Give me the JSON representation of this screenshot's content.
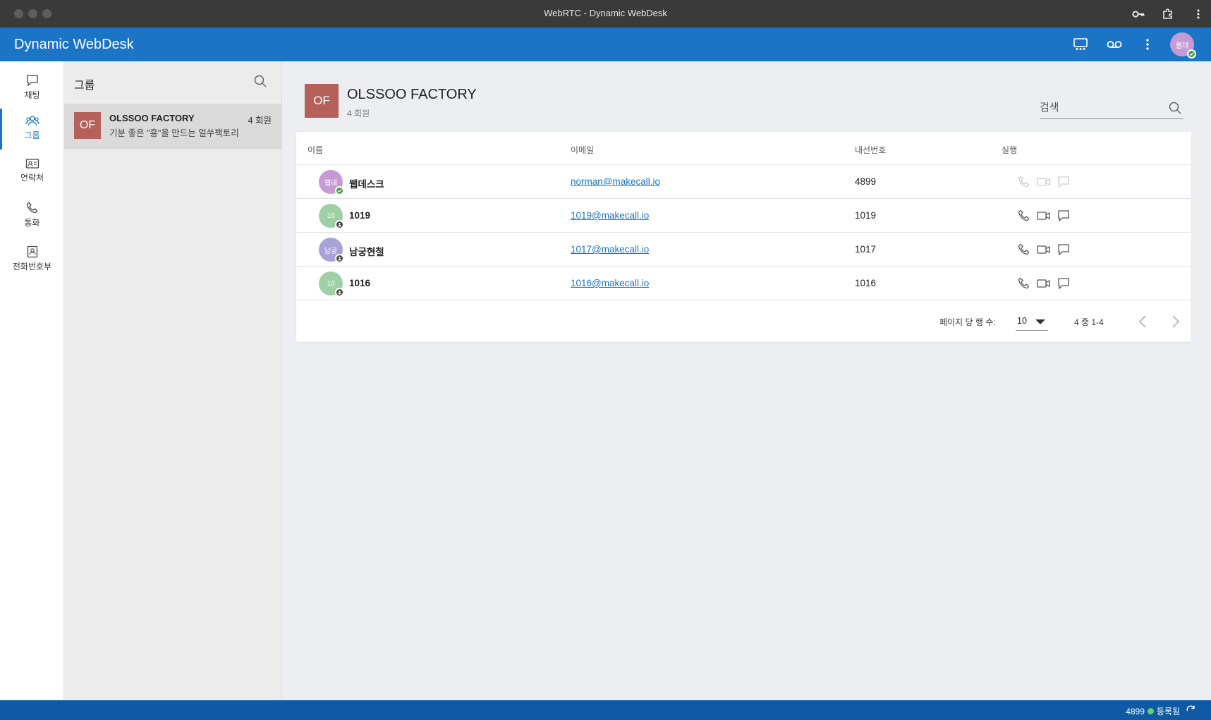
{
  "window": {
    "title": "WebRTC - Dynamic WebDesk"
  },
  "appbar": {
    "title": "Dynamic WebDesk",
    "avatar_text": "웹데"
  },
  "rail": {
    "items": [
      {
        "label": "채팅",
        "icon": "chat-icon"
      },
      {
        "label": "그룹",
        "icon": "group-icon",
        "active": true
      },
      {
        "label": "연락처",
        "icon": "contact-card-icon"
      },
      {
        "label": "통화",
        "icon": "phone-icon"
      },
      {
        "label": "전화번호부",
        "icon": "phonebook-icon"
      }
    ]
  },
  "groups_panel": {
    "title": "그룹",
    "items": [
      {
        "avatar": "OF",
        "name": "OLSSOO FACTORY",
        "description": "기분 좋은 \"흥\"을 만드는 얼쑤팩토리",
        "count": "4 회원"
      }
    ]
  },
  "main": {
    "avatar": "OF",
    "title": "OLSSOO FACTORY",
    "subtitle_count": "4",
    "subtitle_label": "회원",
    "search_placeholder": "검색",
    "columns": {
      "name": "이름",
      "email": "이메일",
      "extension": "내선번호",
      "actions": "실행"
    },
    "members": [
      {
        "avatar": "웹데",
        "avatar_color": "#c69ad4",
        "status": "online",
        "name": "웹데스크",
        "email": "norman@makecall.io",
        "extension": "4899",
        "actions_enabled": false
      },
      {
        "avatar": "10",
        "avatar_color": "#9fcfa7",
        "status": "offline",
        "name": "1019",
        "email": "1019@makecall.io",
        "extension": "1019",
        "actions_enabled": true
      },
      {
        "avatar": "남궁",
        "avatar_color": "#a8a3d6",
        "status": "offline",
        "name": "남궁현철",
        "email": "1017@makecall.io",
        "extension": "1017",
        "actions_enabled": true
      },
      {
        "avatar": "10",
        "avatar_color": "#9fcfa7",
        "status": "offline",
        "name": "1016",
        "email": "1016@makecall.io",
        "extension": "1016",
        "actions_enabled": true
      }
    ],
    "pagination": {
      "rows_per_page_label": "페이지 당 행 수:",
      "rows_per_page": "10",
      "range": "4 중 1-4"
    }
  },
  "statusbar": {
    "extension": "4899",
    "status": "등록됨",
    "status_color": "#66d06a"
  },
  "colors": {
    "primary": "#1b74c6",
    "statusbar": "#0e5aa5",
    "group_avatar": "#b5605a",
    "online": "#43a047"
  }
}
